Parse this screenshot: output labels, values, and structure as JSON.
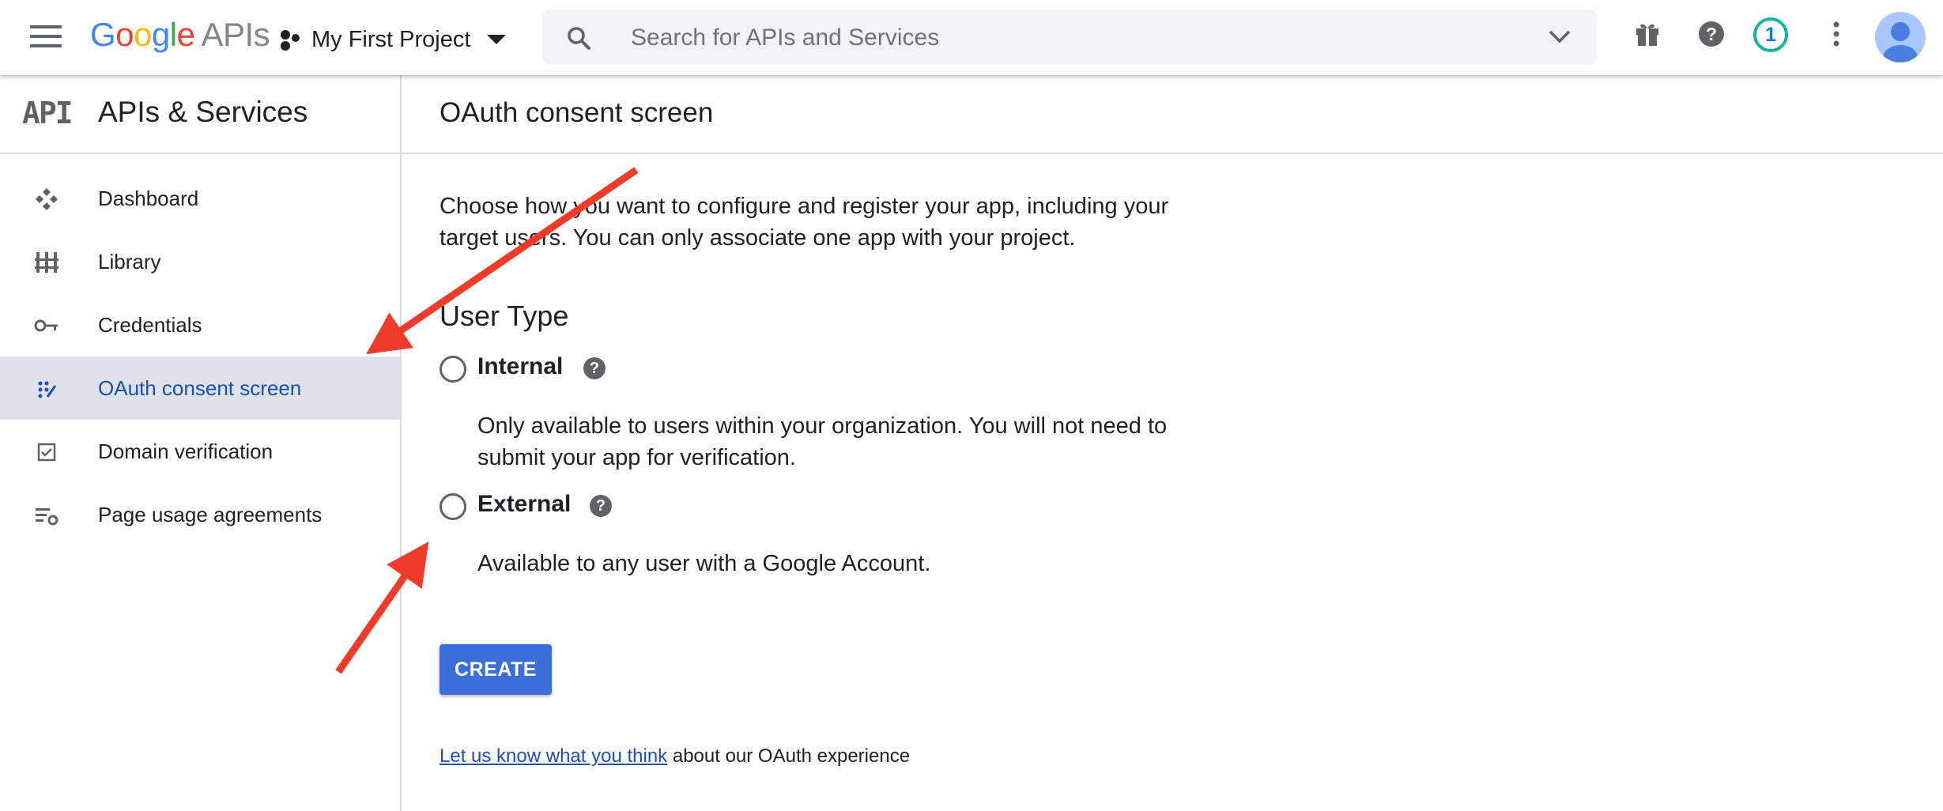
{
  "topbar": {
    "logo": {
      "g": "G",
      "o1": "o",
      "o2": "o",
      "g2": "g",
      "l": "l",
      "e": "e",
      "apis": "APIs"
    },
    "project_label": "My First Project",
    "search": {
      "placeholder": "Search for APIs and Services",
      "value": ""
    },
    "notification_count": "1",
    "icons": [
      "menu-icon",
      "project-dots-icon",
      "dropdown-triangle-icon",
      "search-icon",
      "chevron-down-icon",
      "gift-icon",
      "help-icon",
      "more-vert-icon",
      "avatar-icon"
    ]
  },
  "sidebar": {
    "api_mark": "API",
    "title": "APIs & Services",
    "items": [
      {
        "label": "Dashboard",
        "icon": "dashboard-icon",
        "active": false
      },
      {
        "label": "Library",
        "icon": "library-icon",
        "active": false
      },
      {
        "label": "Credentials",
        "icon": "key-icon",
        "active": false
      },
      {
        "label": "OAuth consent screen",
        "icon": "oauth-icon",
        "active": true
      },
      {
        "label": "Domain verification",
        "icon": "checkbox-icon",
        "active": false
      },
      {
        "label": "Page usage agreements",
        "icon": "settings-list-icon",
        "active": false
      }
    ]
  },
  "main": {
    "title": "OAuth consent screen",
    "intro": "Choose how you want to configure and register your app, including your target users. You can only associate one app with your project.",
    "section_title": "User Type",
    "options": [
      {
        "label": "Internal",
        "description": "Only available to users within your organization. You will not need to submit your app for verification.",
        "selected": false
      },
      {
        "label": "External",
        "description": "Available to any user with a Google Account.",
        "selected": false
      }
    ],
    "create_label": "CREATE",
    "feedback_link": "Let us know what you think",
    "feedback_rest": " about our OAuth experience"
  },
  "colors": {
    "primary": "#3b6fd7",
    "active_nav_bg": "#dfe2e8",
    "active_nav_text": "#1a4fb4",
    "annotation_arrow": "#f03a2a",
    "badge_ring": "#12b5a0"
  }
}
